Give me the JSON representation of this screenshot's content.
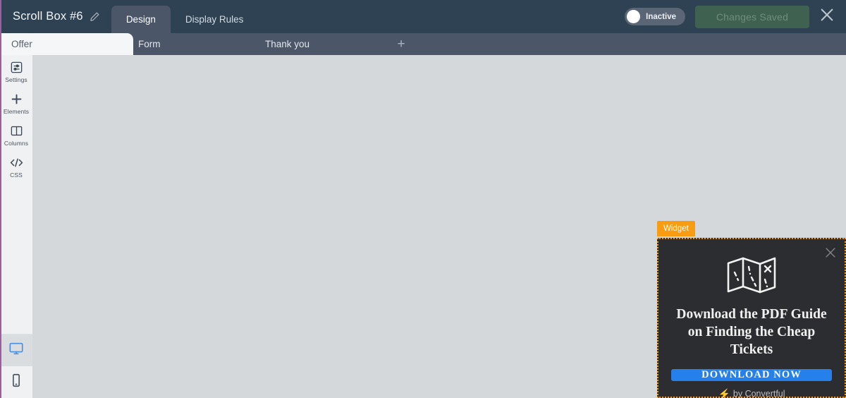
{
  "header": {
    "title": "Scroll Box #6",
    "edit_icon": "pencil-icon",
    "tabs": [
      {
        "label": "Design",
        "active": true
      },
      {
        "label": "Display Rules",
        "active": false
      }
    ],
    "toggle": {
      "label": "Inactive",
      "state": "off"
    },
    "save_button": {
      "label": "Changes Saved",
      "color": "#3f6150",
      "text_color": "#6f8c7d"
    },
    "close_icon": "close-icon",
    "background": "#2f4254"
  },
  "page_tabs": {
    "items": [
      {
        "label": "Offer",
        "active": true
      },
      {
        "label": "Form",
        "active": false
      },
      {
        "label": "Thank you",
        "active": false
      }
    ],
    "add_label": "+",
    "background": "#4b5769",
    "active_background": "#f4f6f7"
  },
  "sidebar": {
    "tools": [
      {
        "label": "Settings",
        "icon": "settings-sliders-icon"
      },
      {
        "label": "Elements",
        "icon": "plus-icon"
      },
      {
        "label": "Columns",
        "icon": "columns-icon"
      },
      {
        "label": "CSS",
        "icon": "code-icon"
      }
    ],
    "devices": [
      {
        "name": "desktop",
        "icon": "desktop-icon",
        "active": true,
        "color": "#4a90e2"
      },
      {
        "name": "mobile",
        "icon": "mobile-icon",
        "active": false,
        "color": "#4a5561"
      }
    ],
    "background": "#f0f1f3"
  },
  "canvas": {
    "background": "#d4d8db"
  },
  "widget": {
    "badge": "Widget",
    "badge_color": "#f89c12",
    "background": "#2b2d31",
    "border_color": "#f89c12",
    "icon": "folded-map-icon",
    "title": "Download the PDF Guide on Finding the Cheap Tickets",
    "cta": {
      "label": "DOWNLOAD NOW",
      "color": "#2680eb"
    },
    "footer": {
      "bolt": "⚡",
      "text": "by Convertful"
    },
    "close_icon": "close-icon"
  }
}
